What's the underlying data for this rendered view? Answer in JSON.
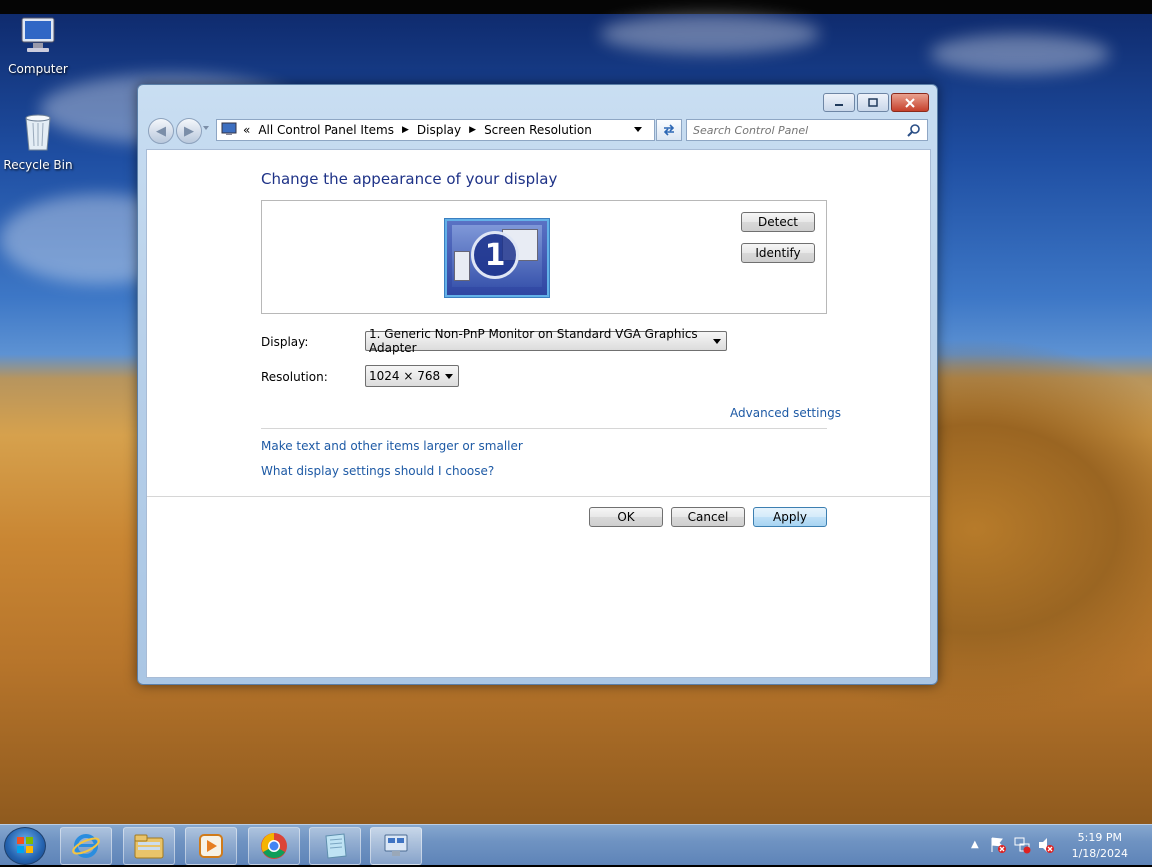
{
  "desktop": {
    "icons": [
      {
        "label": "Computer"
      },
      {
        "label": "Recycle Bin"
      }
    ]
  },
  "window": {
    "address": {
      "overflow": "«",
      "crumbs": [
        "All Control Panel Items",
        "Display",
        "Screen Resolution"
      ]
    },
    "search": {
      "placeholder": "Search Control Panel"
    },
    "heading": "Change the appearance of your display",
    "monitor_number": "1",
    "detect_label": "Detect",
    "identify_label": "Identify",
    "display_label": "Display:",
    "display_value": "1. Generic Non-PnP Monitor on Standard VGA Graphics Adapter",
    "resolution_label": "Resolution:",
    "resolution_value": "1024 × 768",
    "advanced_link": "Advanced settings",
    "text_size_link": "Make text and other items larger or smaller",
    "help_link": "What display settings should I choose?",
    "ok_label": "OK",
    "cancel_label": "Cancel",
    "apply_label": "Apply"
  },
  "taskbar": {
    "apps": [
      "internet-explorer",
      "windows-explorer",
      "media-player",
      "chrome",
      "notepad",
      "control-panel"
    ],
    "time": "5:19 PM",
    "date": "1/18/2024"
  },
  "colors": {
    "heading": "#1e3287",
    "link": "#1e5aa5",
    "window_frame": "#b9d1ea"
  }
}
